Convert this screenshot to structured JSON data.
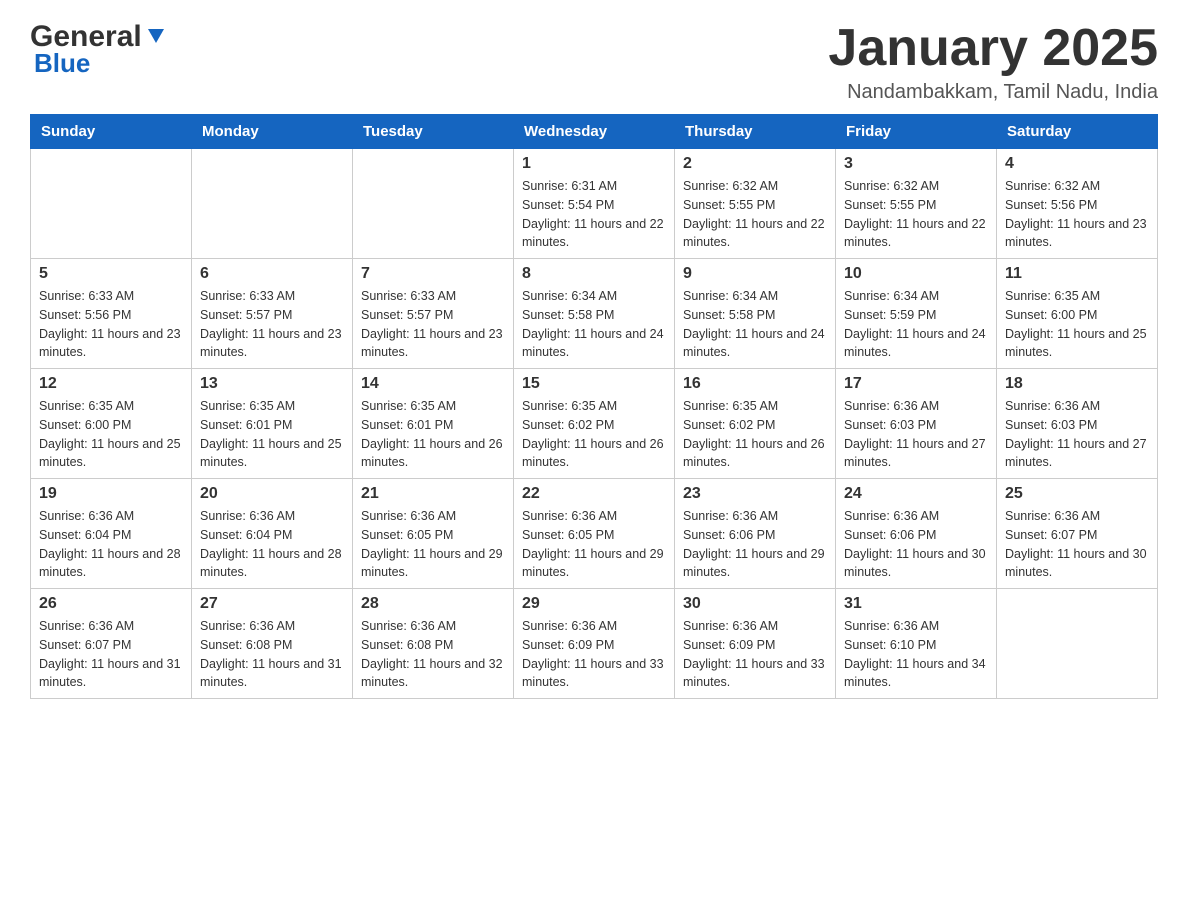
{
  "header": {
    "logo_general": "General",
    "logo_blue": "Blue",
    "title": "January 2025",
    "location": "Nandambakkam, Tamil Nadu, India"
  },
  "weekdays": [
    "Sunday",
    "Monday",
    "Tuesday",
    "Wednesday",
    "Thursday",
    "Friday",
    "Saturday"
  ],
  "weeks": [
    [
      {
        "day": "",
        "sunrise": "",
        "sunset": "",
        "daylight": ""
      },
      {
        "day": "",
        "sunrise": "",
        "sunset": "",
        "daylight": ""
      },
      {
        "day": "",
        "sunrise": "",
        "sunset": "",
        "daylight": ""
      },
      {
        "day": "1",
        "sunrise": "Sunrise: 6:31 AM",
        "sunset": "Sunset: 5:54 PM",
        "daylight": "Daylight: 11 hours and 22 minutes."
      },
      {
        "day": "2",
        "sunrise": "Sunrise: 6:32 AM",
        "sunset": "Sunset: 5:55 PM",
        "daylight": "Daylight: 11 hours and 22 minutes."
      },
      {
        "day": "3",
        "sunrise": "Sunrise: 6:32 AM",
        "sunset": "Sunset: 5:55 PM",
        "daylight": "Daylight: 11 hours and 22 minutes."
      },
      {
        "day": "4",
        "sunrise": "Sunrise: 6:32 AM",
        "sunset": "Sunset: 5:56 PM",
        "daylight": "Daylight: 11 hours and 23 minutes."
      }
    ],
    [
      {
        "day": "5",
        "sunrise": "Sunrise: 6:33 AM",
        "sunset": "Sunset: 5:56 PM",
        "daylight": "Daylight: 11 hours and 23 minutes."
      },
      {
        "day": "6",
        "sunrise": "Sunrise: 6:33 AM",
        "sunset": "Sunset: 5:57 PM",
        "daylight": "Daylight: 11 hours and 23 minutes."
      },
      {
        "day": "7",
        "sunrise": "Sunrise: 6:33 AM",
        "sunset": "Sunset: 5:57 PM",
        "daylight": "Daylight: 11 hours and 23 minutes."
      },
      {
        "day": "8",
        "sunrise": "Sunrise: 6:34 AM",
        "sunset": "Sunset: 5:58 PM",
        "daylight": "Daylight: 11 hours and 24 minutes."
      },
      {
        "day": "9",
        "sunrise": "Sunrise: 6:34 AM",
        "sunset": "Sunset: 5:58 PM",
        "daylight": "Daylight: 11 hours and 24 minutes."
      },
      {
        "day": "10",
        "sunrise": "Sunrise: 6:34 AM",
        "sunset": "Sunset: 5:59 PM",
        "daylight": "Daylight: 11 hours and 24 minutes."
      },
      {
        "day": "11",
        "sunrise": "Sunrise: 6:35 AM",
        "sunset": "Sunset: 6:00 PM",
        "daylight": "Daylight: 11 hours and 25 minutes."
      }
    ],
    [
      {
        "day": "12",
        "sunrise": "Sunrise: 6:35 AM",
        "sunset": "Sunset: 6:00 PM",
        "daylight": "Daylight: 11 hours and 25 minutes."
      },
      {
        "day": "13",
        "sunrise": "Sunrise: 6:35 AM",
        "sunset": "Sunset: 6:01 PM",
        "daylight": "Daylight: 11 hours and 25 minutes."
      },
      {
        "day": "14",
        "sunrise": "Sunrise: 6:35 AM",
        "sunset": "Sunset: 6:01 PM",
        "daylight": "Daylight: 11 hours and 26 minutes."
      },
      {
        "day": "15",
        "sunrise": "Sunrise: 6:35 AM",
        "sunset": "Sunset: 6:02 PM",
        "daylight": "Daylight: 11 hours and 26 minutes."
      },
      {
        "day": "16",
        "sunrise": "Sunrise: 6:35 AM",
        "sunset": "Sunset: 6:02 PM",
        "daylight": "Daylight: 11 hours and 26 minutes."
      },
      {
        "day": "17",
        "sunrise": "Sunrise: 6:36 AM",
        "sunset": "Sunset: 6:03 PM",
        "daylight": "Daylight: 11 hours and 27 minutes."
      },
      {
        "day": "18",
        "sunrise": "Sunrise: 6:36 AM",
        "sunset": "Sunset: 6:03 PM",
        "daylight": "Daylight: 11 hours and 27 minutes."
      }
    ],
    [
      {
        "day": "19",
        "sunrise": "Sunrise: 6:36 AM",
        "sunset": "Sunset: 6:04 PM",
        "daylight": "Daylight: 11 hours and 28 minutes."
      },
      {
        "day": "20",
        "sunrise": "Sunrise: 6:36 AM",
        "sunset": "Sunset: 6:04 PM",
        "daylight": "Daylight: 11 hours and 28 minutes."
      },
      {
        "day": "21",
        "sunrise": "Sunrise: 6:36 AM",
        "sunset": "Sunset: 6:05 PM",
        "daylight": "Daylight: 11 hours and 29 minutes."
      },
      {
        "day": "22",
        "sunrise": "Sunrise: 6:36 AM",
        "sunset": "Sunset: 6:05 PM",
        "daylight": "Daylight: 11 hours and 29 minutes."
      },
      {
        "day": "23",
        "sunrise": "Sunrise: 6:36 AM",
        "sunset": "Sunset: 6:06 PM",
        "daylight": "Daylight: 11 hours and 29 minutes."
      },
      {
        "day": "24",
        "sunrise": "Sunrise: 6:36 AM",
        "sunset": "Sunset: 6:06 PM",
        "daylight": "Daylight: 11 hours and 30 minutes."
      },
      {
        "day": "25",
        "sunrise": "Sunrise: 6:36 AM",
        "sunset": "Sunset: 6:07 PM",
        "daylight": "Daylight: 11 hours and 30 minutes."
      }
    ],
    [
      {
        "day": "26",
        "sunrise": "Sunrise: 6:36 AM",
        "sunset": "Sunset: 6:07 PM",
        "daylight": "Daylight: 11 hours and 31 minutes."
      },
      {
        "day": "27",
        "sunrise": "Sunrise: 6:36 AM",
        "sunset": "Sunset: 6:08 PM",
        "daylight": "Daylight: 11 hours and 31 minutes."
      },
      {
        "day": "28",
        "sunrise": "Sunrise: 6:36 AM",
        "sunset": "Sunset: 6:08 PM",
        "daylight": "Daylight: 11 hours and 32 minutes."
      },
      {
        "day": "29",
        "sunrise": "Sunrise: 6:36 AM",
        "sunset": "Sunset: 6:09 PM",
        "daylight": "Daylight: 11 hours and 33 minutes."
      },
      {
        "day": "30",
        "sunrise": "Sunrise: 6:36 AM",
        "sunset": "Sunset: 6:09 PM",
        "daylight": "Daylight: 11 hours and 33 minutes."
      },
      {
        "day": "31",
        "sunrise": "Sunrise: 6:36 AM",
        "sunset": "Sunset: 6:10 PM",
        "daylight": "Daylight: 11 hours and 34 minutes."
      },
      {
        "day": "",
        "sunrise": "",
        "sunset": "",
        "daylight": ""
      }
    ]
  ]
}
